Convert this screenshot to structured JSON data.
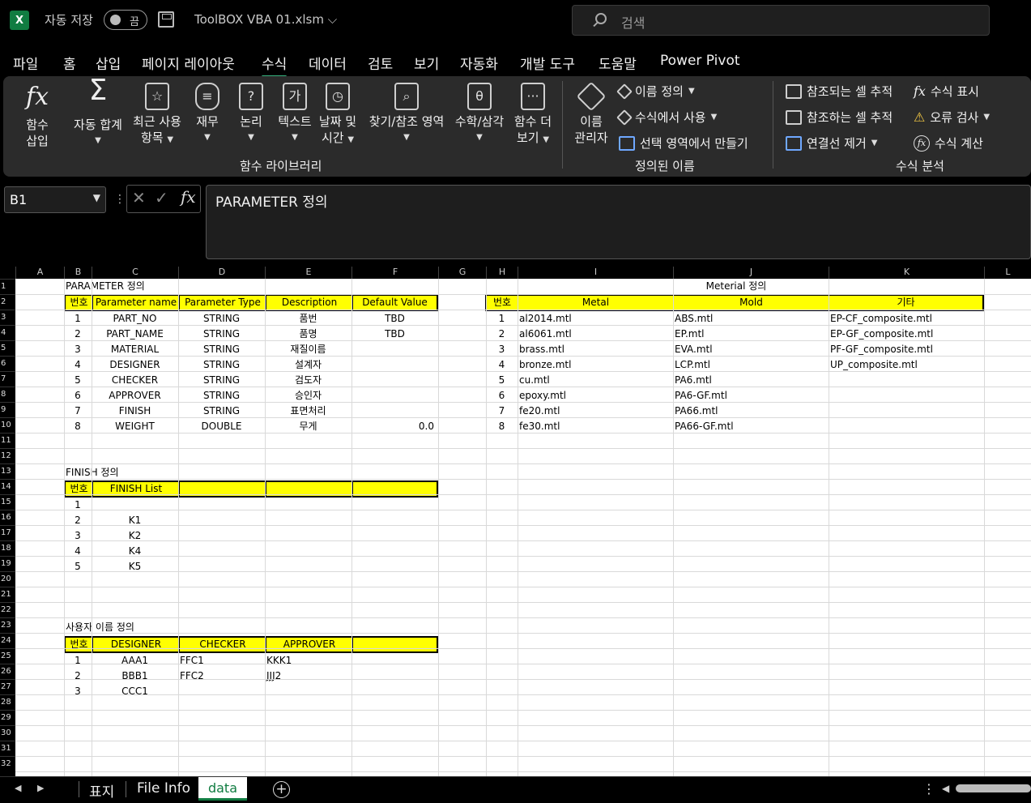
{
  "window": {
    "logo": "X",
    "autosave_label": "자동 저장",
    "autosave_state": "끔",
    "filename": "ToolBOX VBA 01.xlsm ⌵",
    "search_placeholder": "검색"
  },
  "menu": [
    "파일",
    "홈",
    "삽입",
    "페이지 레이아웃",
    "수식",
    "데이터",
    "검토",
    "보기",
    "자동화",
    "개발 도구",
    "도움말",
    "Power Pivot"
  ],
  "ribbon": {
    "insert_function": [
      "함수",
      "삽입"
    ],
    "autosum": "자동 합계",
    "recent": [
      "최근 사용",
      "항목"
    ],
    "financial": "재무",
    "logical": "논리",
    "text": "텍스트",
    "datetime": [
      "날짜 및",
      "시간"
    ],
    "lookup": "찾기/참조 영역",
    "math": "수학/삼각",
    "more": [
      "함수 더",
      "보기"
    ],
    "group_library": "함수 라이브러리",
    "name_manager": [
      "이름",
      "관리자"
    ],
    "define_name": "이름 정의",
    "use_in_formula": "수식에서 사용",
    "create_from_selection": "선택 영역에서 만들기",
    "group_names": "정의된 이름",
    "trace_precedents": "참조되는 셀 추적",
    "trace_dependents": "참조하는 셀 추적",
    "remove_arrows": "연결선 제거",
    "show_formulas": "수식 표시",
    "error_checking": "오류 검사",
    "evaluate": "수식 계산",
    "group_audit": "수식 분석"
  },
  "formula_bar": {
    "cell": "B1",
    "content": "PARAMETER 정의"
  },
  "columns": [
    "A",
    "B",
    "C",
    "D",
    "E",
    "F",
    "G",
    "H",
    "I",
    "J",
    "K",
    "L"
  ],
  "rows": [
    "1",
    "2",
    "3",
    "4",
    "5",
    "6",
    "7",
    "8",
    "9",
    "10",
    "11",
    "12",
    "13",
    "14",
    "15",
    "16",
    "17",
    "18",
    "19",
    "20",
    "21",
    "22",
    "23",
    "24",
    "25",
    "26",
    "27",
    "28",
    "29",
    "30",
    "31",
    "32"
  ],
  "param": {
    "title": "PARAMETER 정의",
    "headers": [
      "번호",
      "Parameter name",
      "Parameter Type",
      "Description",
      "Default Value"
    ],
    "rows": [
      [
        "1",
        "PART_NO",
        "STRING",
        "품번",
        "TBD"
      ],
      [
        "2",
        "PART_NAME",
        "STRING",
        "품명",
        "TBD"
      ],
      [
        "3",
        "MATERIAL",
        "STRING",
        "재질이름",
        ""
      ],
      [
        "4",
        "DESIGNER",
        "STRING",
        "설계자",
        ""
      ],
      [
        "5",
        "CHECKER",
        "STRING",
        "검도자",
        ""
      ],
      [
        "6",
        "APPROVER",
        "STRING",
        "승인자",
        ""
      ],
      [
        "7",
        "FINISH",
        "STRING",
        "표면처리",
        ""
      ],
      [
        "8",
        "WEIGHT",
        "DOUBLE",
        "무게",
        "0.0"
      ]
    ]
  },
  "material": {
    "title": "Meterial 정의",
    "headers": [
      "번호",
      "Metal",
      "Mold",
      "기타"
    ],
    "rows": [
      [
        "1",
        "al2014.mtl",
        "ABS.mtl",
        "EP-CF_composite.mtl"
      ],
      [
        "2",
        "al6061.mtl",
        "EP.mtl",
        "EP-GF_composite.mtl"
      ],
      [
        "3",
        "brass.mtl",
        "EVA.mtl",
        "PF-GF_composite.mtl"
      ],
      [
        "4",
        "bronze.mtl",
        "LCP.mtl",
        "UP_composite.mtl"
      ],
      [
        "5",
        "cu.mtl",
        "PA6.mtl",
        ""
      ],
      [
        "6",
        "epoxy.mtl",
        "PA6-GF.mtl",
        ""
      ],
      [
        "7",
        "fe20.mtl",
        "PA66.mtl",
        ""
      ],
      [
        "8",
        "fe30.mtl",
        "PA66-GF.mtl",
        ""
      ]
    ]
  },
  "finish": {
    "title": "FINISH 정의",
    "headers": [
      "번호",
      "FINISH List"
    ],
    "rows": [
      [
        "1",
        ""
      ],
      [
        "2",
        "K1"
      ],
      [
        "3",
        "K2"
      ],
      [
        "4",
        "K4"
      ],
      [
        "5",
        "K5"
      ]
    ]
  },
  "users": {
    "title": "사용자 이름 정의",
    "headers": [
      "번호",
      "DESIGNER",
      "CHECKER",
      "APPROVER"
    ],
    "rows": [
      [
        "1",
        "AAA1",
        "FFC1",
        "KKK1"
      ],
      [
        "2",
        "BBB1",
        "FFC2",
        "JJJ2"
      ],
      [
        "3",
        "CCC1",
        "",
        ""
      ]
    ]
  },
  "tabs": [
    "표지",
    "File Info",
    "data"
  ]
}
